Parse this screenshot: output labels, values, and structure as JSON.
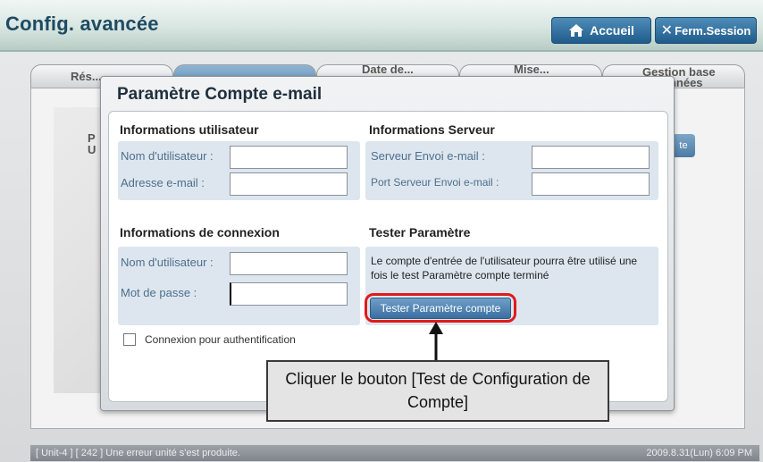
{
  "header": {
    "title": "Config. avancée",
    "home_button": "Accueil",
    "logout_button": "Ferm.Session"
  },
  "background_tabs": [
    {
      "label": "Rés..."
    },
    {
      "label": ""
    },
    {
      "label": "Date de..."
    },
    {
      "label": "Mise..."
    },
    {
      "label": "Gestion base\ndonnées"
    }
  ],
  "background_peek": {
    "left_text": "P\nU",
    "right_button": "te"
  },
  "dialog": {
    "title": "Paramètre Compte e-mail",
    "user_info": {
      "heading": "Informations utilisateur",
      "username_label": "Nom d'utilisateur :",
      "username_value": "",
      "email_label": "Adresse e-mail :",
      "email_value": ""
    },
    "server_info": {
      "heading": "Informations Serveur",
      "send_server_label": "Serveur Envoi e-mail :",
      "send_server_value": "",
      "send_port_label": "Port Serveur Envoi e-mail :",
      "send_port_value": ""
    },
    "connection_info": {
      "heading": "Informations de connexion",
      "username_label": "Nom d'utilisateur :",
      "username_value": "",
      "password_label": "Mot de passe :",
      "password_value": ""
    },
    "test": {
      "heading": "Tester Paramètre",
      "description": "Le compte d'entrée de l'utilisateur pourra être utilisé une fois le test Paramètre compte terminé",
      "button": "Tester Paramètre compte"
    },
    "auth_checkbox": {
      "label": "Connexion pour authentification",
      "checked": false
    }
  },
  "callout": {
    "text": "Cliquer le bouton [Test de Configuration de Compte]"
  },
  "statusbar": {
    "message": "[ Unit-4 ] [ 242 ] Une erreur unité s'est produite.",
    "datetime": "2009.8.31(Lun)  6:09 PM"
  },
  "colors": {
    "highlight": "#e11a1a",
    "accent": "#3b6f9f"
  }
}
